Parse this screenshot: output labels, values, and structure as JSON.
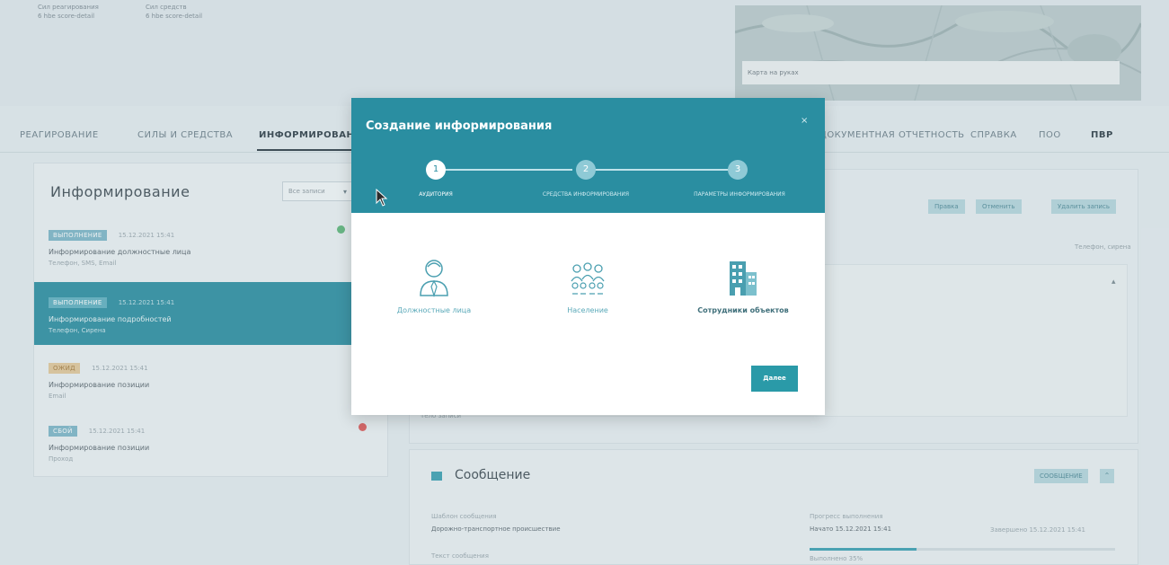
{
  "top": {
    "mini_labels": [
      "Сил реагирования",
      "Сил средств"
    ],
    "mini_sub": [
      "6 hbe score-detail",
      "6 hbe score-detail"
    ],
    "map_caption": "Карта на руках"
  },
  "nav": {
    "items": [
      "РЕАГИРОВАНИЕ",
      "СИЛЫ И СРЕДСТВА",
      "ИНФОРМИРОВАНИЕ",
      "ДОКУМЕНТНАЯ ОТЧЕТНОСТЬ",
      "СПРАВКА",
      "ПОО",
      "ПВР"
    ],
    "active_index": 2
  },
  "left_panel": {
    "title": "Информирование",
    "filter": "Все записи",
    "cards": [
      {
        "status": "ВЫПОЛНЕНИЕ",
        "date": "15.12.2021 15:41",
        "title": "Информирование должностные лица",
        "sub": "Телефон, SMS, Email"
      },
      {
        "status": "ВЫПОЛНЕНИЕ",
        "date": "15.12.2021 15:41",
        "title": "Информирование подробностей",
        "sub": "Телефон, Сирена"
      },
      {
        "status": "ОЖИД",
        "date": "15.12.2021 15:41",
        "title": "Информирование позиции",
        "sub": "Email"
      },
      {
        "status": "СБОЙ",
        "date": "15.12.2021 15:41",
        "title": "Информирование позиции",
        "sub": "Проход"
      }
    ]
  },
  "right_panel": {
    "buttons": [
      "Правка",
      "Отменить",
      "Удалить запись"
    ],
    "small_right": "Телефон, сирена",
    "footer_text": "Тело записи"
  },
  "message_panel": {
    "title": "Сообщение",
    "button": "СООБЩЕНИЕ",
    "template_label": "Шаблон сообщения",
    "template_value": "Дорожно-транспортное происшествие",
    "text_label": "Текст сообщения",
    "progress_label": "Прогресс выполнения",
    "progress_start": "Начато 15.12.2021 15:41",
    "progress_end": "Завершено 15.12.2021 15:41",
    "progress_value": 0.35,
    "progress_note": "Выполнено 35%"
  },
  "modal": {
    "title": "Создание информирования",
    "close": "×",
    "steps": [
      {
        "num": "1",
        "label": "АУДИТОРИЯ"
      },
      {
        "num": "2",
        "label": "СРЕДСТВА ИНФОРМИРОВАНИЯ"
      },
      {
        "num": "3",
        "label": "ПАРАМЕТРЫ ИНФОРМИРОВАНИЯ"
      }
    ],
    "options": [
      {
        "label": "Должностные лица"
      },
      {
        "label": "Население"
      },
      {
        "label": "Сотрудники объектов"
      }
    ],
    "next": "Далее"
  },
  "colors": {
    "accent": "#2a8ea1",
    "danger": "#e05a5a",
    "success": "#5fb87a"
  }
}
